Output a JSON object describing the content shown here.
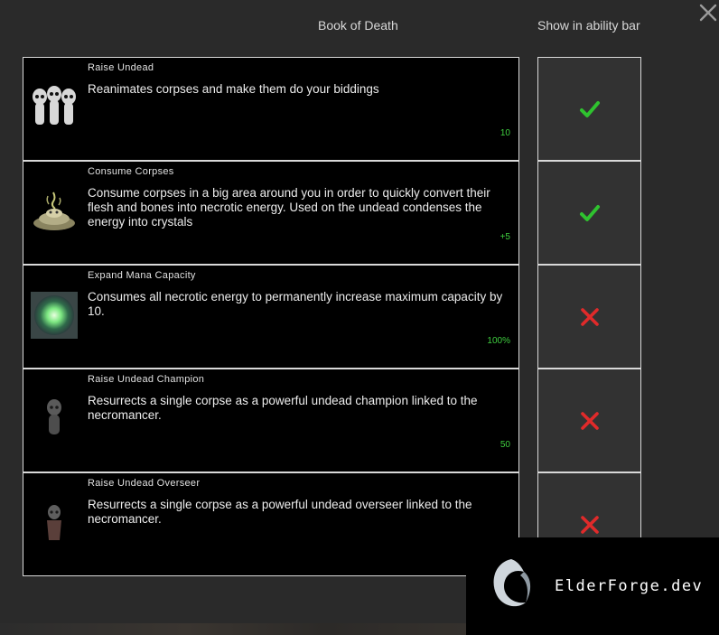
{
  "header": {
    "book_title": "Book of Death",
    "bar_title": "Show in ability bar",
    "close_icon": "close-icon"
  },
  "abilities": [
    {
      "name": "Raise Undead",
      "description": "Reanimates corpses and make them do your biddings",
      "cost": "10",
      "icon": "skeleton-group-icon",
      "show_in_bar": true
    },
    {
      "name": "Consume Corpses",
      "description": "Consume corpses in a big area around you in order to quickly convert their flesh and bones into necrotic energy. Used on the undead condenses the energy into crystals",
      "cost": "+5",
      "icon": "bone-pile-icon",
      "show_in_bar": true
    },
    {
      "name": "Expand Mana Capacity",
      "description": "Consumes all necrotic energy to permanently increase maximum capacity by 10.",
      "cost": "100%",
      "icon": "mana-orb-icon",
      "show_in_bar": false
    },
    {
      "name": "Raise Undead Champion",
      "description": "Resurrects a single corpse as a powerful undead champion linked to the necromancer.",
      "cost": "50",
      "icon": "undead-champion-icon",
      "show_in_bar": false
    },
    {
      "name": "Raise Undead Overseer",
      "description": "Resurrects a single corpse as a powerful undead overseer linked to the necromancer.",
      "cost": "",
      "icon": "undead-overseer-icon",
      "show_in_bar": false
    }
  ],
  "colors": {
    "check": "#2fc22f",
    "cross": "#e02a2a",
    "cost": "#3fce3f"
  },
  "watermark": {
    "text": "ElderForge.dev",
    "icon": "dragon-logo-icon"
  }
}
